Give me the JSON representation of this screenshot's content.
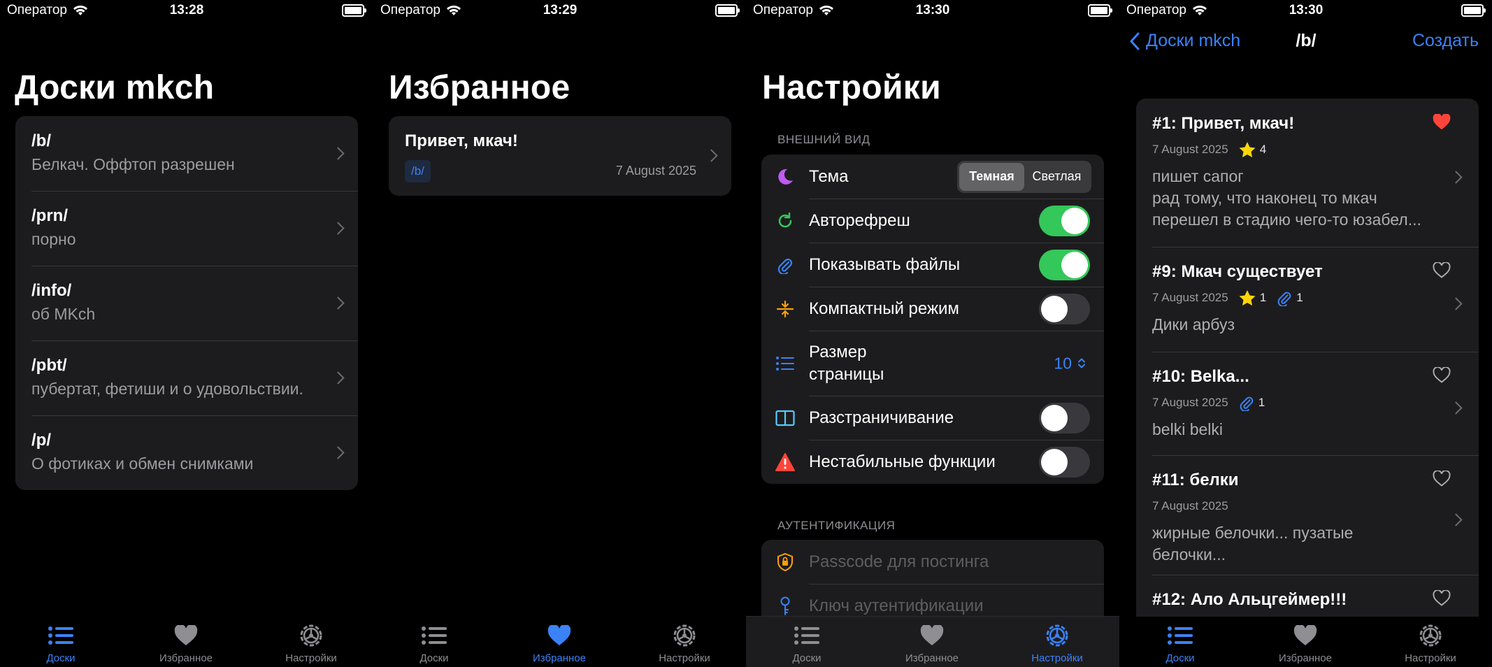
{
  "colors": {
    "accent": "#3b82f6",
    "toggle_on": "#34c759",
    "heart_fill": "#ff453a",
    "card_bg": "#1c1c1e"
  },
  "status": {
    "carrier": "Оператор",
    "times": [
      "13:28",
      "13:29",
      "13:30",
      "13:30"
    ]
  },
  "tabs": [
    "Доски",
    "Избранное",
    "Настройки"
  ],
  "boards_screen": {
    "title": "Доски mkch",
    "boards": [
      {
        "code": "/b/",
        "desc": "Белкач. Оффтоп разрешен"
      },
      {
        "code": "/prn/",
        "desc": "порно"
      },
      {
        "code": "/info/",
        "desc": "об MKch"
      },
      {
        "code": "/pbt/",
        "desc": "пубертат, фетиши и о удовольствии."
      },
      {
        "code": "/p/",
        "desc": "О фотиках и обмен снимками"
      }
    ]
  },
  "favorites_screen": {
    "title": "Избранное",
    "item": {
      "title": "Привет, мкач!",
      "tag": "/b/",
      "date": "7 August 2025"
    }
  },
  "settings_screen": {
    "title": "Настройки",
    "appearance_header": "ВНЕШНИЙ ВИД",
    "theme_label": "Тема",
    "theme_options": [
      "Темная",
      "Светлая"
    ],
    "theme_selected": "Темная",
    "autorefresh_label": "Авторефреш",
    "autorefresh_on": true,
    "show_files_label": "Показывать файлы",
    "show_files_on": true,
    "compact_label": "Компактный режим",
    "compact_on": false,
    "page_size_label": "Размер\nстраницы",
    "page_size_value": "10",
    "pagination_label": "Разстраничивание",
    "pagination_on": false,
    "unstable_label": "Нестабильные функции",
    "unstable_on": false,
    "auth_header": "АУТЕНТИФИКАЦИЯ",
    "passcode_label": "Passcode для постинга",
    "auth_key_label": "Ключ аутентификации"
  },
  "threads_screen": {
    "back_label": "Доски mkch",
    "title": "/b/",
    "action_label": "Создать",
    "threads": [
      {
        "title": "#1: Привет, мкач!",
        "date": "7 August 2025",
        "stars": "4",
        "files": null,
        "favorited": true,
        "body": "пишет сапог\nрад тому, что наконец то мкач\nперешел в стадию чего-то юзабел..."
      },
      {
        "title": "#9: Мкач существует",
        "date": "7 August 2025",
        "stars": "1",
        "files": "1",
        "favorited": false,
        "body": "Дики арбуз"
      },
      {
        "title": "#10: Belka...",
        "date": "7 August 2025",
        "stars": null,
        "files": "1",
        "favorited": false,
        "body": "belki belki"
      },
      {
        "title": "#11: белки",
        "date": "7 August 2025",
        "stars": null,
        "files": null,
        "favorited": false,
        "body": "жирные белочки... пузатые\nбелочки..."
      },
      {
        "title": "#12: Ало Альцгеймер!!!",
        "date": "",
        "stars": null,
        "files": null,
        "favorited": false,
        "body": ""
      }
    ]
  }
}
